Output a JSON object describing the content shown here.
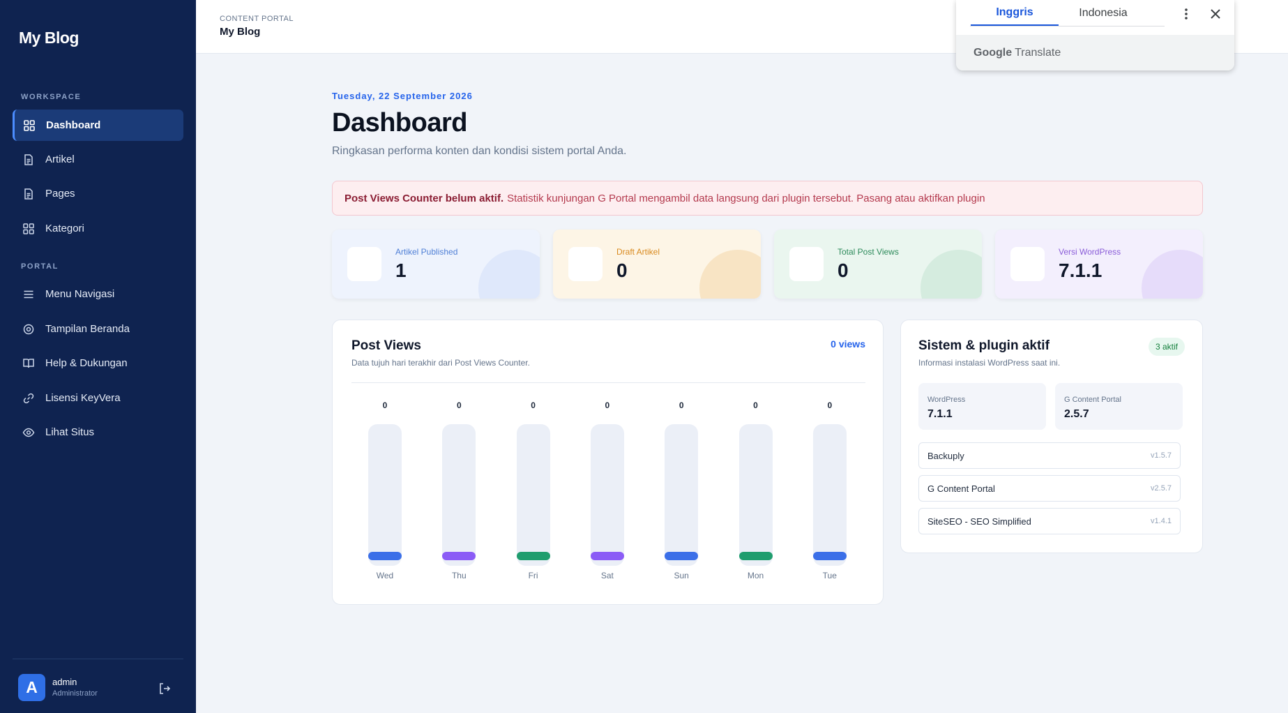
{
  "sidebar": {
    "brand": "My Blog",
    "sections": [
      "WORKSPACE",
      "PORTAL"
    ],
    "items": [
      {
        "label": "Dashboard",
        "icon": "grid-icon",
        "active": true
      },
      {
        "label": "Artikel",
        "icon": "document-icon"
      },
      {
        "label": "Pages",
        "icon": "document-icon"
      },
      {
        "label": "Kategori",
        "icon": "grid-icon"
      },
      {
        "label": "Menu Navigasi",
        "icon": "menu-icon"
      },
      {
        "label": "Tampilan Beranda",
        "icon": "settings-icon"
      },
      {
        "label": "Help & Dukungan",
        "icon": "book-icon"
      },
      {
        "label": "Lisensi KeyVera",
        "icon": "link-icon"
      },
      {
        "label": "Lihat Situs",
        "icon": "eye-icon"
      }
    ],
    "user": {
      "initial": "A",
      "name": "admin",
      "role": "Administrator"
    }
  },
  "topbar": {
    "subtitle": "CONTENT PORTAL",
    "title": "My Blog"
  },
  "page": {
    "date": "Tuesday, 22 September 2026",
    "title": "Dashboard",
    "lead": "Ringkasan performa konten dan kondisi sistem portal Anda."
  },
  "alert": {
    "strong": "Post Views Counter belum aktif.",
    "text": "Statistik kunjungan G Portal mengambil data langsung dari plugin tersebut. Pasang atau aktifkan plugin"
  },
  "stats": [
    {
      "label": "Artikel Published",
      "value": "1",
      "color": "#4f7fd6"
    },
    {
      "label": "Draft Artikel",
      "value": "0",
      "color": "#d98a1f"
    },
    {
      "label": "Total Post Views",
      "value": "0",
      "color": "#2c8a5a"
    },
    {
      "label": "Versi WordPress",
      "value": "7.1.1",
      "color": "#8a5cd8"
    }
  ],
  "post_views": {
    "title": "Post Views",
    "subtitle": "Data tujuh hari terakhir dari Post Views Counter.",
    "total": "0 views"
  },
  "chart_data": {
    "type": "bar",
    "categories": [
      "Wed",
      "Thu",
      "Fri",
      "Sat",
      "Sun",
      "Mon",
      "Tue"
    ],
    "values": [
      0,
      0,
      0,
      0,
      0,
      0,
      0
    ],
    "value_labels": [
      "0",
      "0",
      "0",
      "0",
      "0",
      "0",
      "0"
    ],
    "colors": [
      "#3b6fe8",
      "#8b5cf6",
      "#1f9d6e",
      "#8b5cf6",
      "#3b6fe8",
      "#1f9d6e",
      "#3b6fe8"
    ]
  },
  "system": {
    "title": "Sistem & plugin aktif",
    "subtitle": "Informasi instalasi WordPress saat ini.",
    "badge": "3 aktif",
    "info": [
      {
        "key": "WordPress",
        "value": "7.1.1"
      },
      {
        "key": "G Content Portal",
        "value": "2.5.7"
      }
    ],
    "plugins": [
      {
        "name": "Backuply",
        "version": "v1.5.7"
      },
      {
        "name": "G Content Portal",
        "version": "v2.5.7"
      },
      {
        "name": "SiteSEO - SEO Simplified",
        "version": "v1.4.1"
      }
    ]
  },
  "translate": {
    "tabs": [
      "Inggris",
      "Indonesia"
    ],
    "footer_brand": "Google",
    "footer_text": "Translate"
  }
}
